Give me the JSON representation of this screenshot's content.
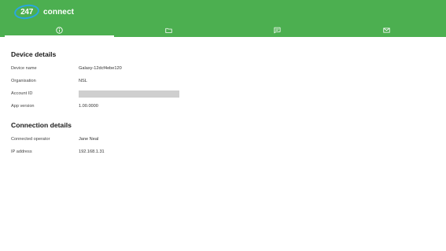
{
  "header": {
    "logo_number": "247",
    "logo_word": "connect",
    "brand_color": "#4caf50",
    "logo_ring_color": "#2aa7df"
  },
  "tabs": [
    {
      "icon": "info-icon",
      "active": true
    },
    {
      "icon": "folder-icon",
      "active": false
    },
    {
      "icon": "message-icon",
      "active": false
    },
    {
      "icon": "mail-icon",
      "active": false
    }
  ],
  "device_details": {
    "title": "Device details",
    "rows": [
      {
        "label": "Device name",
        "value": "Galaxy-12dcf4ebe120"
      },
      {
        "label": "Organisation",
        "value": "NSL"
      },
      {
        "label": "Account ID",
        "value": ""
      },
      {
        "label": "App version",
        "value": "1.00.0000"
      }
    ]
  },
  "connection_details": {
    "title": "Connection details",
    "rows": [
      {
        "label": "Connected operator",
        "value": "Jane Neal"
      },
      {
        "label": "IP address",
        "value": "192.168.1.31"
      }
    ]
  }
}
